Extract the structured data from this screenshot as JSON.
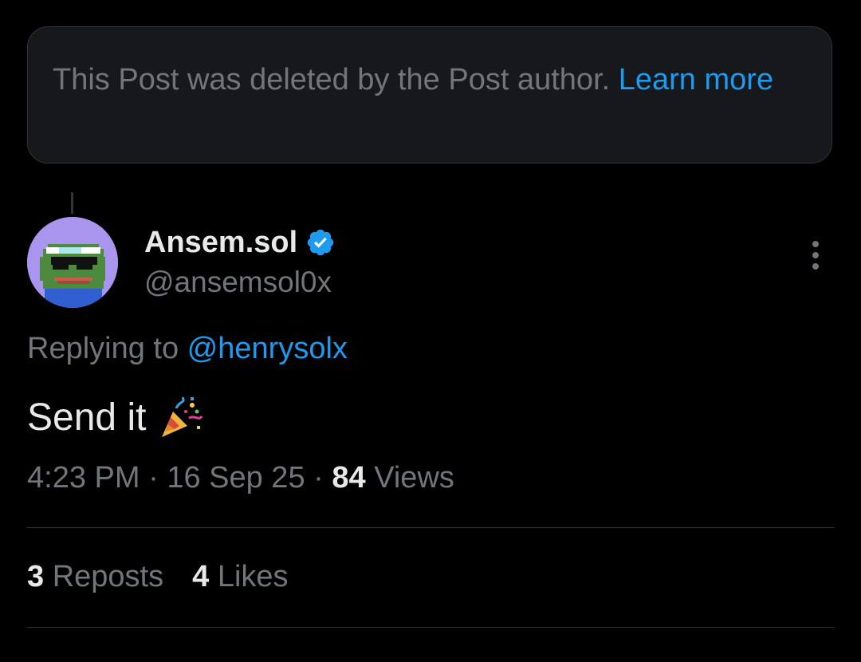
{
  "deleted_notice": {
    "text": "This Post was deleted by the Post author.",
    "link_label": "Learn more"
  },
  "post": {
    "display_name": "Ansem.sol",
    "handle": "@ansemsol0x",
    "replying_prefix": "Replying to",
    "replying_handle": "@henrysolx",
    "text": "Send it",
    "time": "4:23 PM",
    "date": "16 Sep 25",
    "views_count": "84",
    "views_label": "Views",
    "separator": "·"
  },
  "stats": {
    "reposts_count": "3",
    "reposts_label": "Reposts",
    "likes_count": "4",
    "likes_label": "Likes"
  },
  "colors": {
    "background": "#000000",
    "accent": "#1d9bf0",
    "secondary_text": "#71767b",
    "primary_text": "#e7e9ea",
    "card": "#16181c",
    "avatar_bg": "#a995ee"
  },
  "icons": {
    "verified": "verified-badge-icon",
    "more": "more-vertical-icon",
    "emoji": "party-popper-icon"
  }
}
